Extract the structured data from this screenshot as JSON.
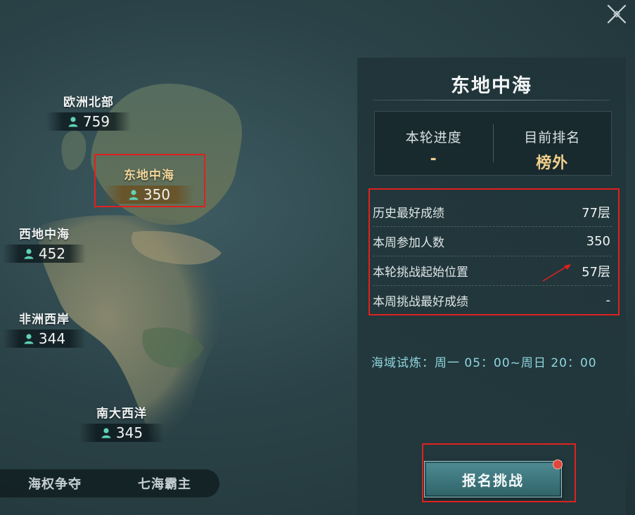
{
  "regions": [
    {
      "name": "欧洲北部",
      "count": "759"
    },
    {
      "name": "东地中海",
      "count": "350"
    },
    {
      "name": "西地中海",
      "count": "452"
    },
    {
      "name": "非洲西岸",
      "count": "344"
    },
    {
      "name": "南大西洋",
      "count": "345"
    }
  ],
  "bottom_tabs": [
    "海权争夺",
    "七海霸主"
  ],
  "panel": {
    "title": "东地中海",
    "stats": [
      {
        "label": "本轮进度",
        "value": "-"
      },
      {
        "label": "目前排名",
        "value": "榜外"
      }
    ],
    "info_rows": [
      {
        "label": "历史最好成绩",
        "value": "77层"
      },
      {
        "label": "本周参加人数",
        "value": "350"
      },
      {
        "label": "本轮挑战起始位置",
        "value": "57层"
      },
      {
        "label": "本周挑战最好成绩",
        "value": "-"
      }
    ],
    "schedule": "海域试炼：周一 05：00~周日 20：00",
    "signup_label": "报名挑战"
  },
  "icons": {
    "close": "close-x-icon",
    "person": "person-icon"
  },
  "colors": {
    "gold": "#f0cf8c",
    "highlight_red": "#e0201e",
    "cyan_text": "#8fd6e0",
    "person_icon": "#5fd2b8"
  }
}
